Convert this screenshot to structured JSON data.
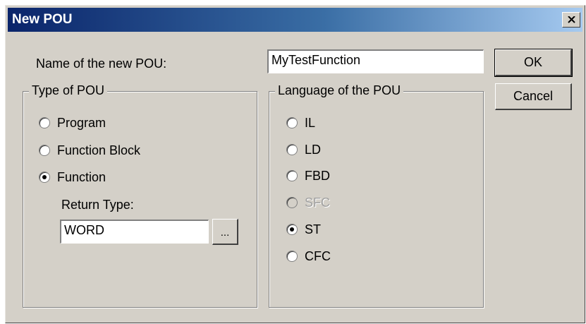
{
  "dialog": {
    "title": "New POU",
    "close_icon": "close-x-icon"
  },
  "name_field": {
    "label": "Name of the new POU:",
    "value": "MyTestFunction"
  },
  "buttons": {
    "ok": "OK",
    "cancel": "Cancel",
    "browse": "..."
  },
  "type_group": {
    "legend": "Type of POU",
    "options": [
      {
        "label": "Program",
        "checked": false
      },
      {
        "label": "Function Block",
        "checked": false
      },
      {
        "label": "Function",
        "checked": true
      }
    ],
    "return_type_label": "Return Type:",
    "return_type_value": "WORD"
  },
  "language_group": {
    "legend": "Language of the POU",
    "options": [
      {
        "label": "IL",
        "checked": false,
        "disabled": false
      },
      {
        "label": "LD",
        "checked": false,
        "disabled": false
      },
      {
        "label": "FBD",
        "checked": false,
        "disabled": false
      },
      {
        "label": "SFC",
        "checked": false,
        "disabled": true
      },
      {
        "label": "ST",
        "checked": true,
        "disabled": false
      },
      {
        "label": "CFC",
        "checked": false,
        "disabled": false
      }
    ]
  },
  "colors": {
    "titlebar_start": "#0a246a",
    "titlebar_end": "#a6caf0",
    "dialog_face": "#d4d0c8"
  }
}
